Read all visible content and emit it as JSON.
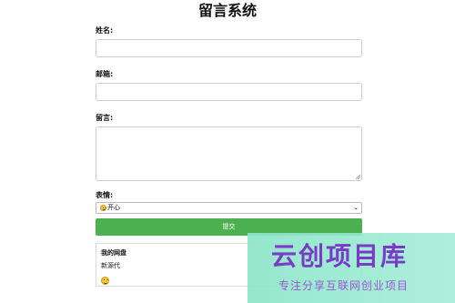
{
  "page": {
    "title": "留言系统"
  },
  "form": {
    "name_label": "姓名:",
    "name_value": "",
    "email_label": "邮箱:",
    "email_value": "",
    "message_label": "留言:",
    "message_value": "",
    "mood_label": "表情:",
    "mood_selected": "开心",
    "mood_selected_icon": "smiley-emoji",
    "submit_label": "提交"
  },
  "messages": {
    "title": "我的网盘",
    "items": [
      {
        "text": "新源代",
        "emoji": "smiley-emoji"
      }
    ]
  },
  "watermark": {
    "main": "云创项目库",
    "sub": "专注分享互联网创业项目"
  },
  "colors": {
    "submit_bg": "#4caf50",
    "watermark_bg": "#8ce6c8",
    "watermark_text": "#7a3cc8"
  }
}
